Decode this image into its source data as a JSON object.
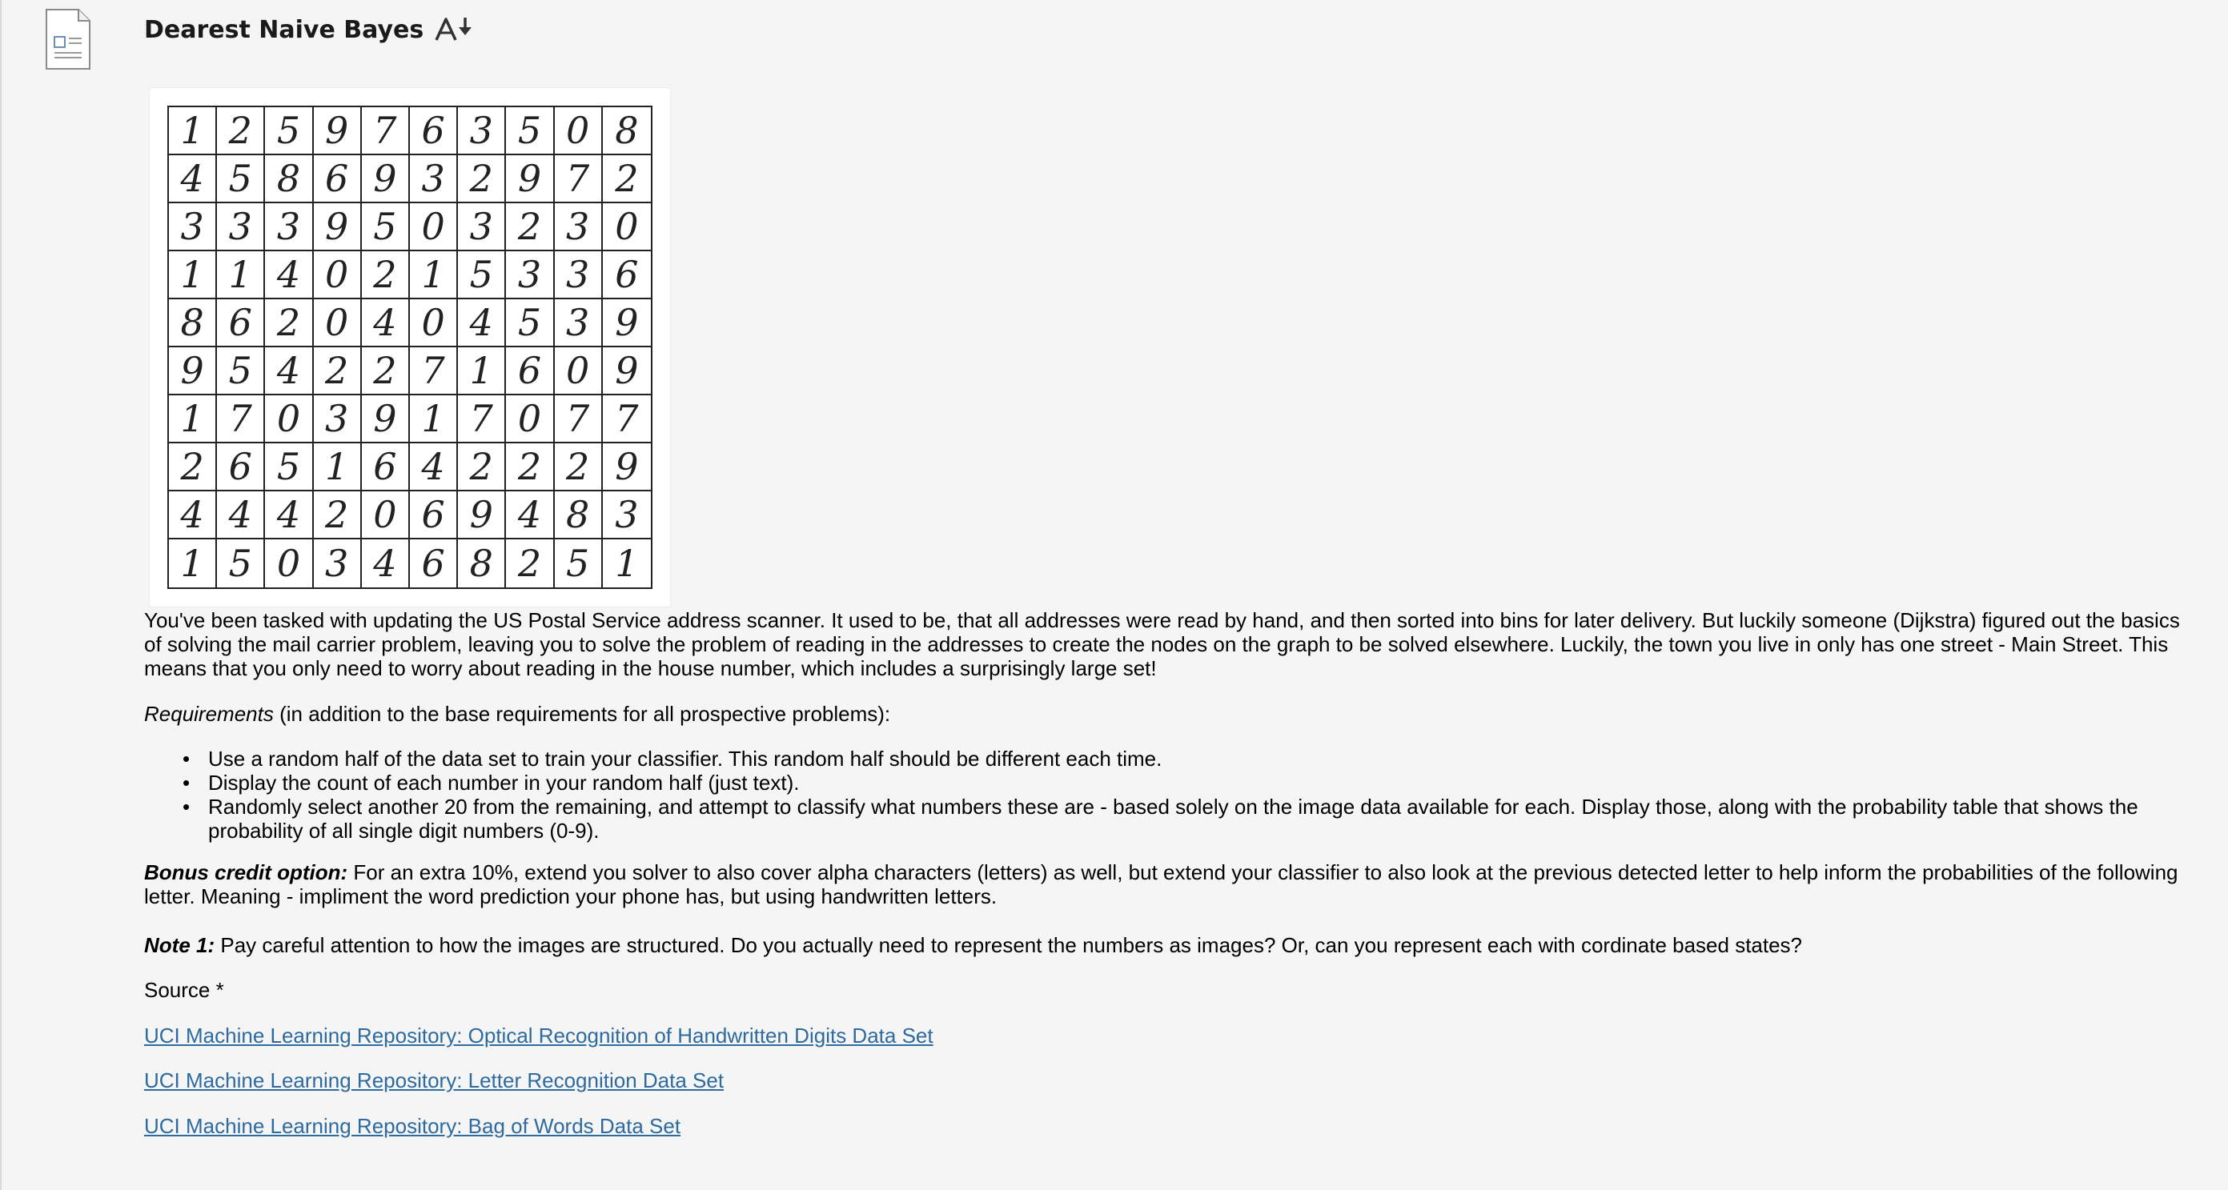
{
  "header": {
    "title": "Dearest Naive Bayes",
    "doc_icon": "document-icon",
    "font_icon": "font-size-icon"
  },
  "figure": {
    "digit_rows": [
      [
        "1",
        "2",
        "5",
        "9",
        "7",
        "6",
        "3",
        "5",
        "0",
        "8"
      ],
      [
        "4",
        "5",
        "8",
        "6",
        "9",
        "3",
        "2",
        "9",
        "7",
        "2"
      ],
      [
        "3",
        "3",
        "3",
        "9",
        "5",
        "0",
        "3",
        "2",
        "3",
        "0"
      ],
      [
        "1",
        "1",
        "4",
        "0",
        "2",
        "1",
        "5",
        "3",
        "3",
        "6"
      ],
      [
        "8",
        "6",
        "2",
        "0",
        "4",
        "0",
        "4",
        "5",
        "3",
        "9"
      ],
      [
        "9",
        "5",
        "4",
        "2",
        "2",
        "7",
        "1",
        "6",
        "0",
        "9"
      ],
      [
        "1",
        "7",
        "0",
        "3",
        "9",
        "1",
        "7",
        "0",
        "7",
        "7"
      ],
      [
        "2",
        "6",
        "5",
        "1",
        "6",
        "4",
        "2",
        "2",
        "2",
        "9"
      ],
      [
        "4",
        "4",
        "4",
        "2",
        "0",
        "6",
        "9",
        "4",
        "8",
        "3"
      ],
      [
        "1",
        "5",
        "0",
        "3",
        "4",
        "6",
        "8",
        "2",
        "5",
        "1"
      ]
    ]
  },
  "body": {
    "intro": "You've been tasked with updating the US Postal Service address scanner.  It used to be, that all addresses were read by hand, and then sorted into bins for later delivery.  But luckily someone (Dijkstra) figured out the basics of solving the mail carrier problem, leaving you to solve the problem of reading in the addresses to create the nodes on the graph to be solved elsewhere.  Luckily, the town you live in only has one street - Main Street.  This means that you only need to worry about reading in the house number, which includes a surprisingly large set!",
    "requirements_label": "Requirements",
    "requirements_rest": " (in addition to the base requirements for all prospective problems):",
    "requirements": [
      "Use a random half of the data set to train your classifier.  This random half should be different each time.",
      "Display the count of each number in your random half (just text).",
      "Randomly select another 20 from the remaining, and attempt to classify what numbers these are - based solely on the image data available for each.  Display those, along with the probability table that shows the probability of all single digit numbers (0-9)."
    ],
    "bullet": "•",
    "bonus_label": "Bonus credit option:",
    "bonus_text": " For an extra 10%, extend you solver to also cover alpha characters (letters) as well, but extend your classifier to also look at the previous detected letter to help inform the probabilities of the following letter.  Meaning - impliment the word prediction your phone has, but using handwritten letters.",
    "note_label": "Note 1:",
    "note_text": " Pay careful attention to how the images are structured.  Do you actually need to represent the numbers as images?  Or, can you represent each with cordinate based states?",
    "source_label": "Source *"
  },
  "links": [
    "UCI Machine Learning Repository: Optical Recognition of Handwritten Digits Data Set",
    "UCI Machine Learning Repository: Letter Recognition Data Set",
    "UCI Machine Learning Repository: Bag of Words Data Set"
  ],
  "colors": {
    "link": "#2d6a9f",
    "background": "#f5f5f5"
  }
}
